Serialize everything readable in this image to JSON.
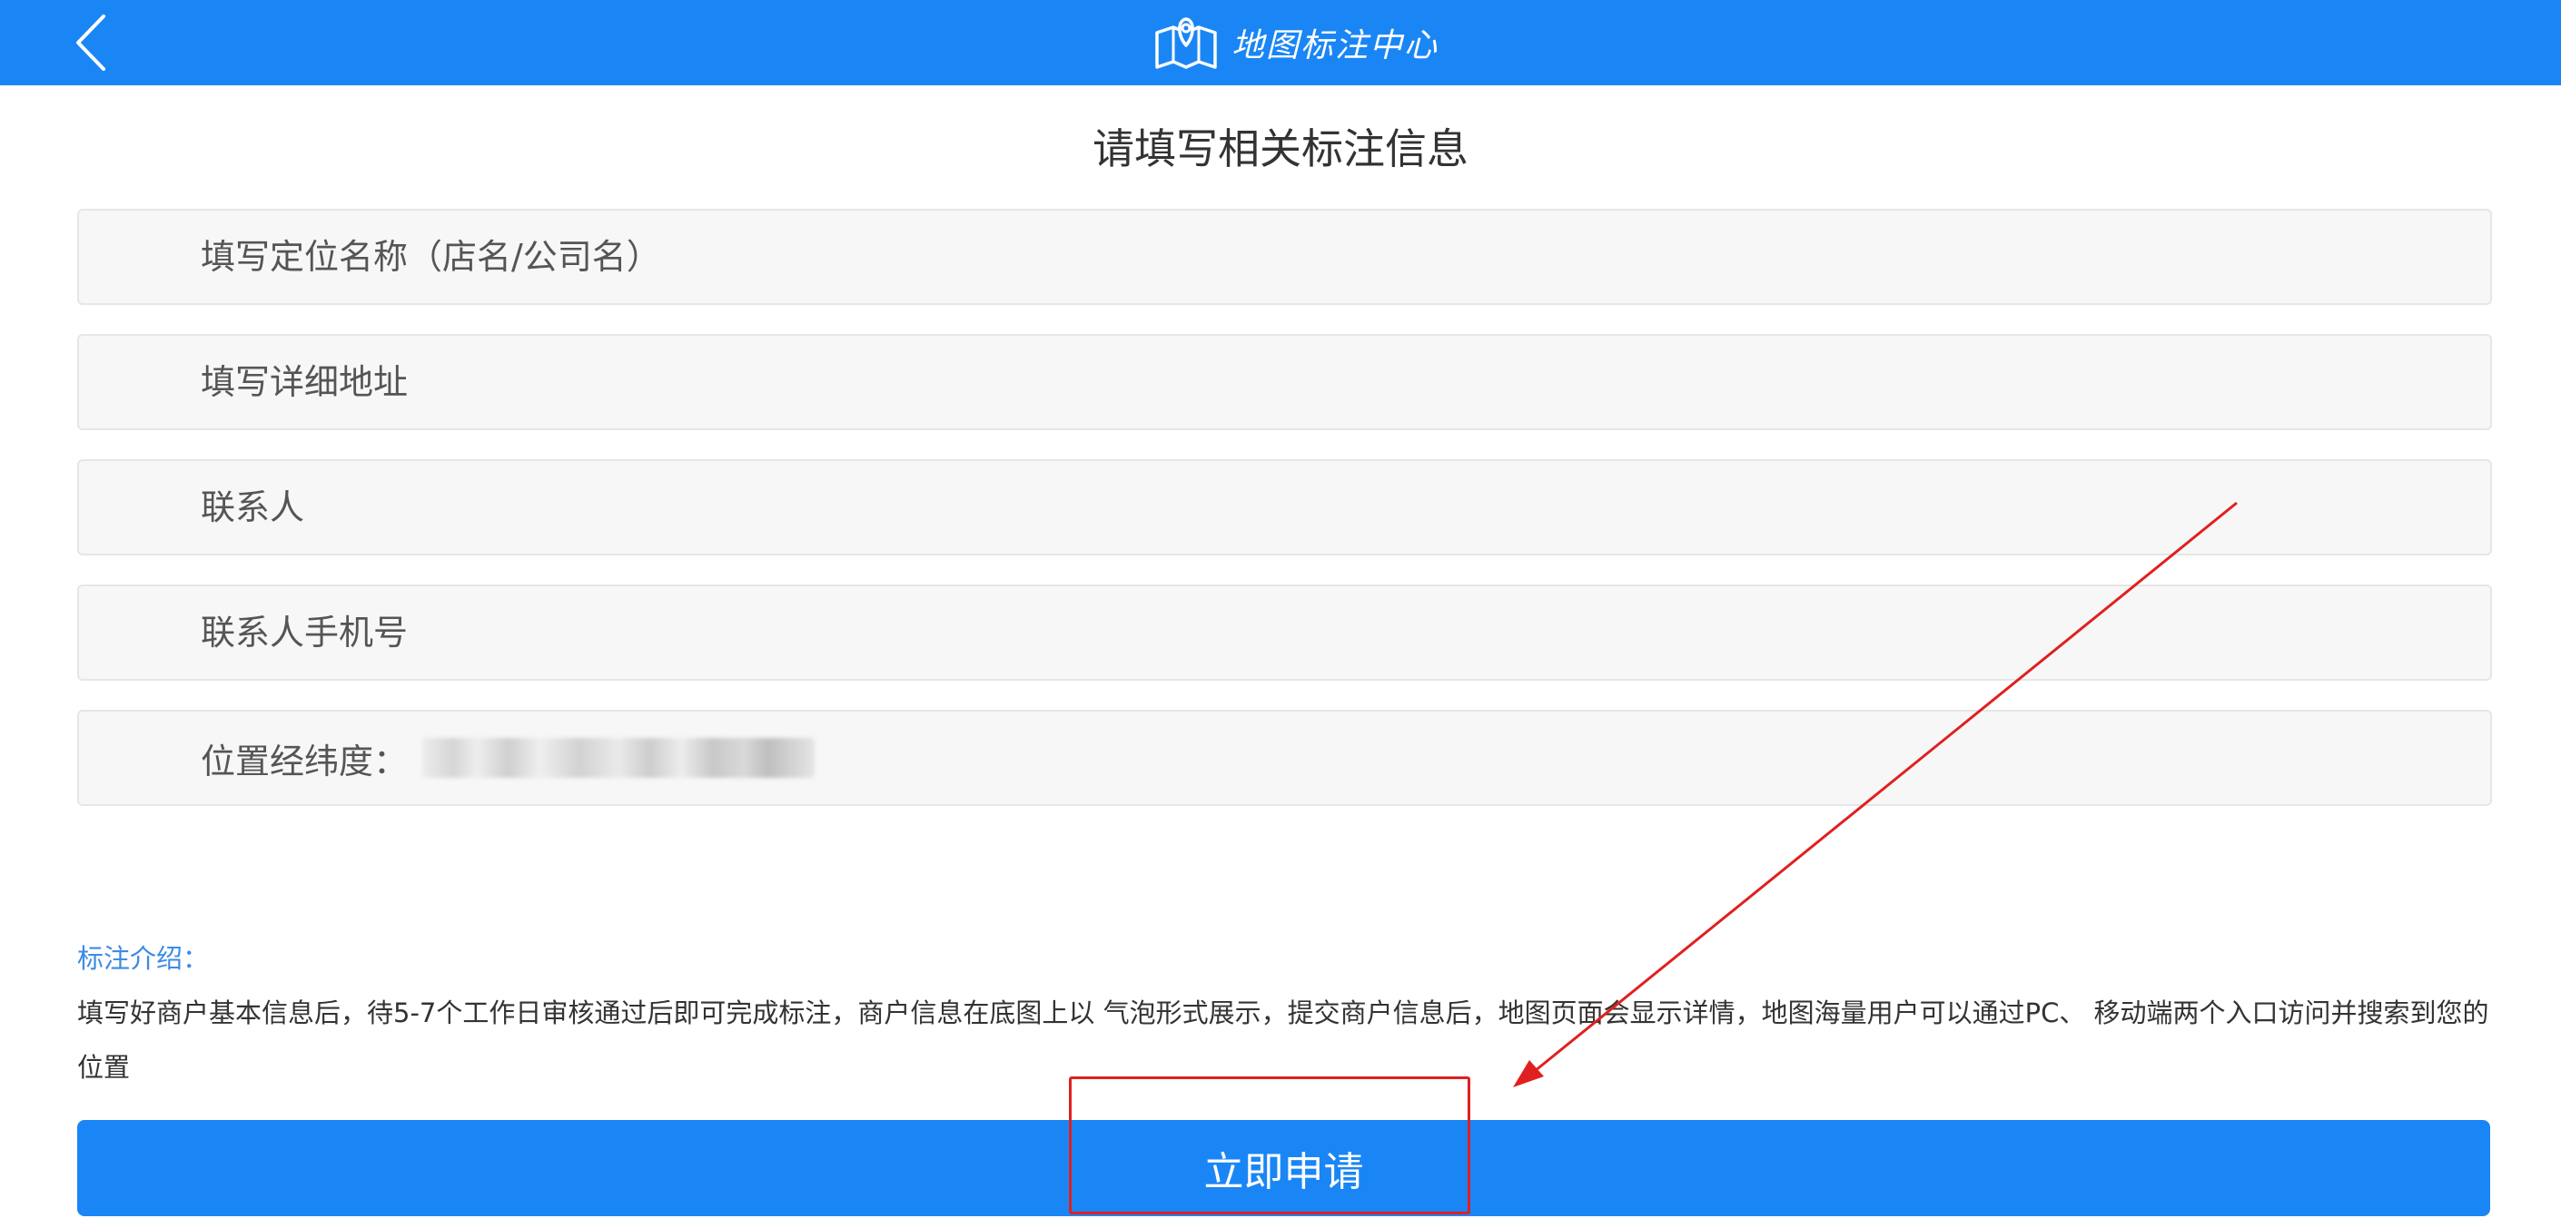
{
  "header": {
    "back_icon": "chevron-left-icon",
    "brand_icon": "map-pin-icon",
    "title": "地图标注中心"
  },
  "page_title": "请填写相关标注信息",
  "form": {
    "name_placeholder": "填写定位名称（店名/公司名）",
    "address_placeholder": "填写详细地址",
    "contact_placeholder": "联系人",
    "phone_placeholder": "联系人手机号",
    "latlng_label": "位置经纬度："
  },
  "intro": {
    "title": "标注介绍：",
    "body": "填写好商户基本信息后，待5-7个工作日审核通过后即可完成标注，商户信息在底图上以 气泡形式展示，提交商户信息后，地图页面会显示详情，地图海量用户可以通过PC、 移动端两个入口访问并搜索到您的位置"
  },
  "submit": {
    "label": "立即申请"
  },
  "colors": {
    "primary": "#1a86f5",
    "intro_title": "#3d8be6",
    "annotation": "#e02020"
  }
}
